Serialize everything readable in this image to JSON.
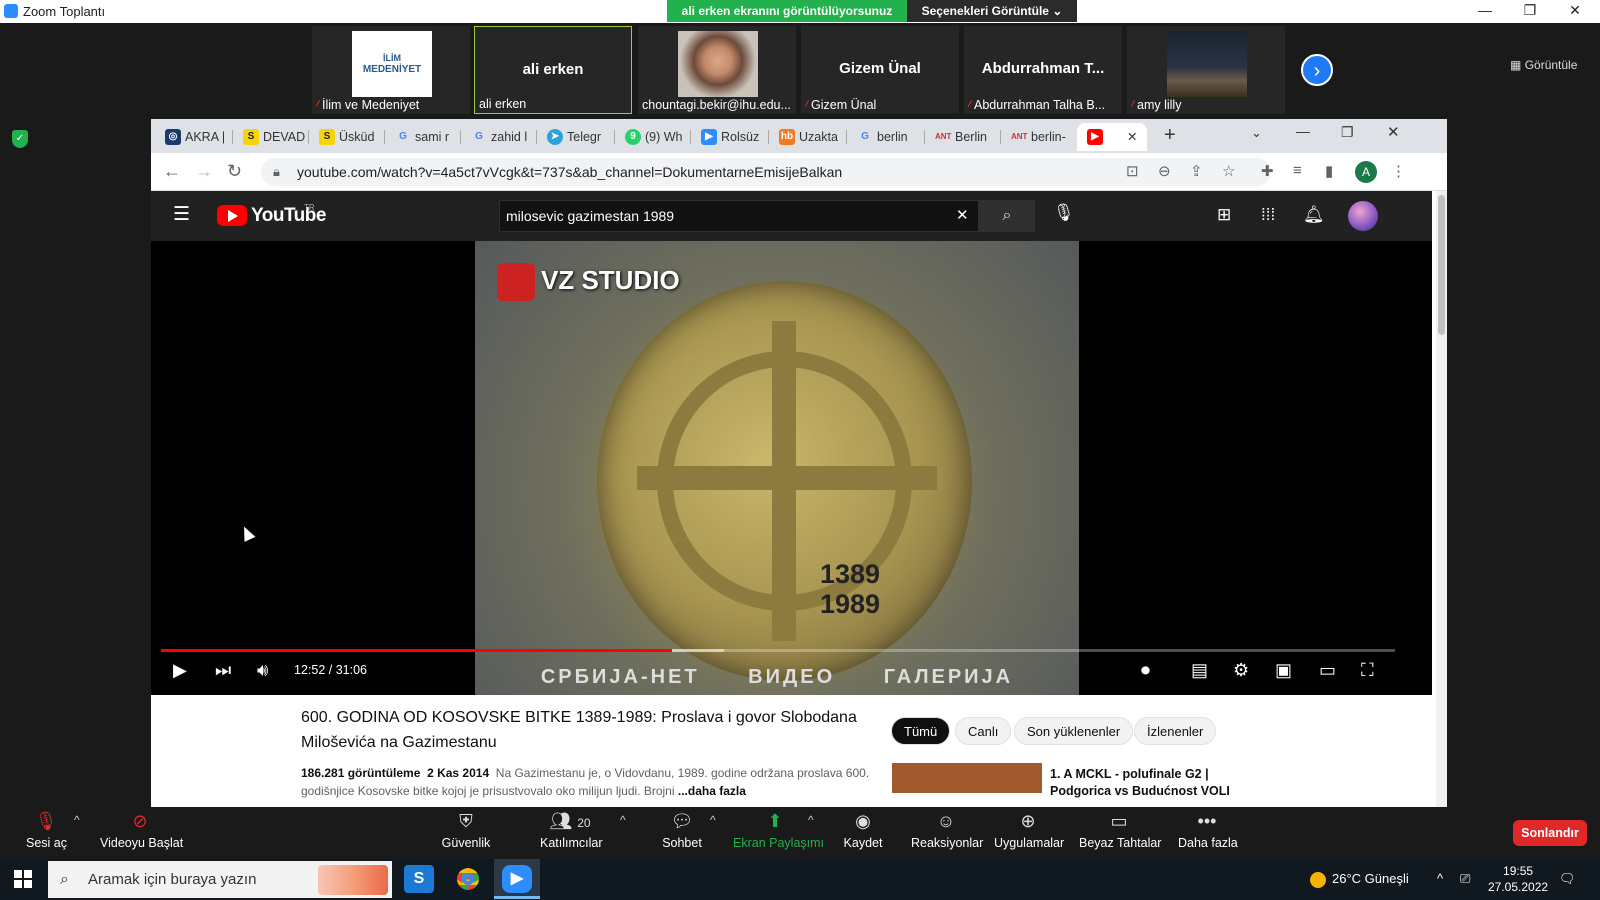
{
  "zoom": {
    "window_title": "Zoom Toplantı",
    "share_banner": "ali erken ekranını görüntülüyorsunuz",
    "view_options": "Seçenekleri Görüntüle",
    "gallery_view_label": "Görüntüle",
    "participants": [
      {
        "display": "",
        "footer": "İlim ve Medeniyet",
        "muted": true,
        "logo_line1": "İLİM",
        "logo_line2": "MEDENİYET"
      },
      {
        "display": "ali erken",
        "footer": "ali erken",
        "muted": false
      },
      {
        "display": "",
        "footer": "chountagi.bekir@ihu.edu...",
        "muted": false
      },
      {
        "display": "Gizem Ünal",
        "footer": "Gizem Ünal",
        "muted": true
      },
      {
        "display": "Abdurrahman T...",
        "footer": "Abdurrahman Talha B...",
        "muted": true
      },
      {
        "display": "",
        "footer": "amy lilly",
        "muted": true
      }
    ],
    "controls": {
      "unmute": "Sesi aç",
      "start_video": "Videoyu Başlat",
      "security": "Güvenlik",
      "participants": "Katılımcılar",
      "participant_count": "20",
      "chat": "Sohbet",
      "share_screen": "Ekran Paylaşımı",
      "record": "Kaydet",
      "reactions": "Reaksiyonlar",
      "apps": "Uygulamalar",
      "whiteboards": "Beyaz Tahtalar",
      "more": "Daha fazla",
      "end": "Sonlandır"
    }
  },
  "browser": {
    "tabs": [
      {
        "label": "AKRA |",
        "icon": "globe"
      },
      {
        "label": "DEVAD",
        "icon": "S"
      },
      {
        "label": "Üsküd",
        "icon": "S"
      },
      {
        "label": "sami r",
        "icon": "G"
      },
      {
        "label": "zahid l",
        "icon": "G"
      },
      {
        "label": "Telegr",
        "icon": "telegram"
      },
      {
        "label": "(9) Wh",
        "icon": "whatsapp"
      },
      {
        "label": "Rolsüz",
        "icon": "zoom"
      },
      {
        "label": "Uzakta",
        "icon": "hb"
      },
      {
        "label": "berlin",
        "icon": "G"
      },
      {
        "label": "Berlin",
        "icon": "ANT"
      },
      {
        "label": "berlin-",
        "icon": "ANT"
      }
    ],
    "url": "youtube.com/watch?v=4a5ct7vVcgk&t=737s&ab_channel=DokumentarneEmisijeBalkan",
    "profile_initial": "A"
  },
  "youtube": {
    "logo_text": "YouTube",
    "region": "TR",
    "search_query": "milosevic gazimestan 1989",
    "player": {
      "current_time": "12:52",
      "duration": "31:06",
      "time_display": "12:52 / 31:06",
      "progress_fraction": 0.414,
      "buffer_fraction": 0.456,
      "watermark": "VZ STUDIO",
      "coin_year_top": "1389",
      "coin_year_bottom": "1989",
      "caption": "СРБИЈА-НЕТ ВИДЕО ГАЛЕРИЈА"
    },
    "video": {
      "title": "600. GODINA OD KOSOVSKE BITKE 1389-1989: Proslava i govor Slobodana Miloševića na Gazimestanu",
      "views": "186.281 görüntüleme",
      "date": "2 Kas 2014",
      "description": "Na Gazimestanu je, o Vidovdanu, 1989. godine održana proslava 600. godišnjice Kosovske bitke kojoj je prisustvovalo oko milijun ljudi. Brojni",
      "more": "...daha fazla"
    },
    "chips": [
      "Tümü",
      "Canlı",
      "Son yüklenenler",
      "İzlenenler"
    ],
    "recommendation": {
      "title": "1. A MCKL - polufinale G2 | Podgorica vs Budućnost VOLI"
    }
  },
  "taskbar": {
    "search_placeholder": "Aramak için buraya yazın",
    "weather": "26°C Güneşli",
    "time": "19:55",
    "date": "27.05.2022"
  },
  "colors": {
    "zoom_green": "#22b14c",
    "zoom_end_red": "#e02828",
    "yt_red": "#ff0000",
    "zoom_blue": "#1e7bf5"
  }
}
